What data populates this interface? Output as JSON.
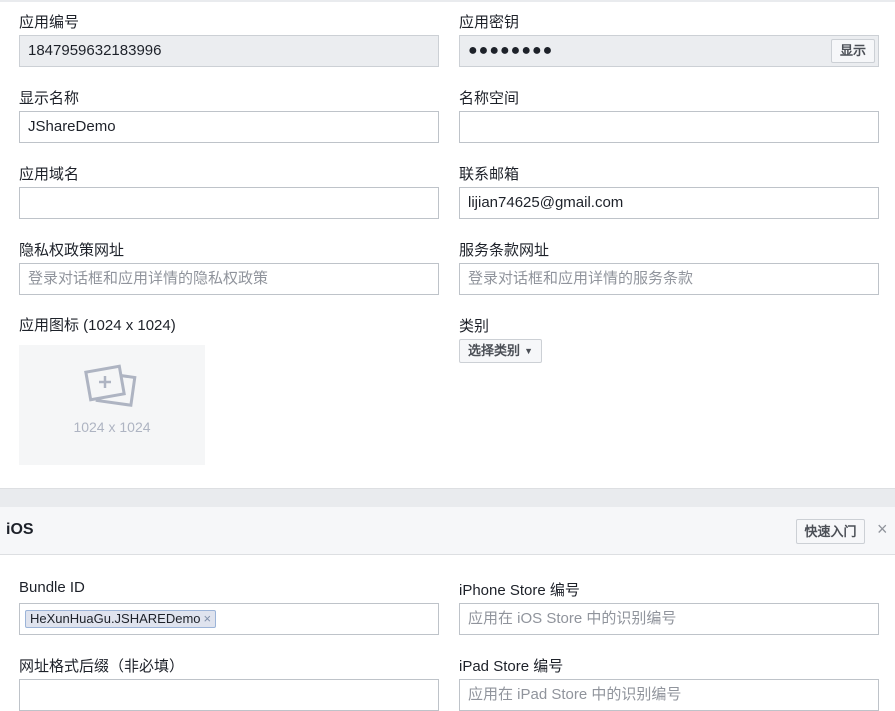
{
  "app_settings": {
    "app_id_label": "应用编号",
    "app_id_value": "1847959632183996",
    "app_secret_label": "应用密钥",
    "app_secret_value": "●●●●●●●●",
    "show_button": "显示",
    "display_name_label": "显示名称",
    "display_name_value": "JShareDemo",
    "namespace_label": "名称空间",
    "namespace_value": "",
    "app_domain_label": "应用域名",
    "app_domain_value": "",
    "contact_email_label": "联系邮箱",
    "contact_email_value": "lijian74625@gmail.com",
    "privacy_url_label": "隐私权政策网址",
    "privacy_url_placeholder": "登录对话框和应用详情的隐私权政策",
    "terms_url_label": "服务条款网址",
    "terms_url_placeholder": "登录对话框和应用详情的服务条款",
    "app_icon_label": "应用图标 (1024 x 1024)",
    "app_icon_size": "1024 x 1024",
    "category_label": "类别",
    "category_button": "选择类别"
  },
  "ios_section": {
    "title": "iOS",
    "quick_start_button": "快速入门",
    "close_glyph": "×",
    "bundle_id_label": "Bundle ID",
    "bundle_id_tag": "HeXunHuaGu.JSHAREDemo",
    "tag_remove_glyph": "×",
    "iphone_store_label": "iPhone Store 编号",
    "iphone_store_placeholder": "应用在 iOS Store 中的识别编号",
    "url_suffix_label": "网址格式后缀（非必填）",
    "url_suffix_value": "",
    "ipad_store_label": "iPad Store 编号",
    "ipad_store_placeholder": "应用在 iPad Store 中的识别编号"
  }
}
